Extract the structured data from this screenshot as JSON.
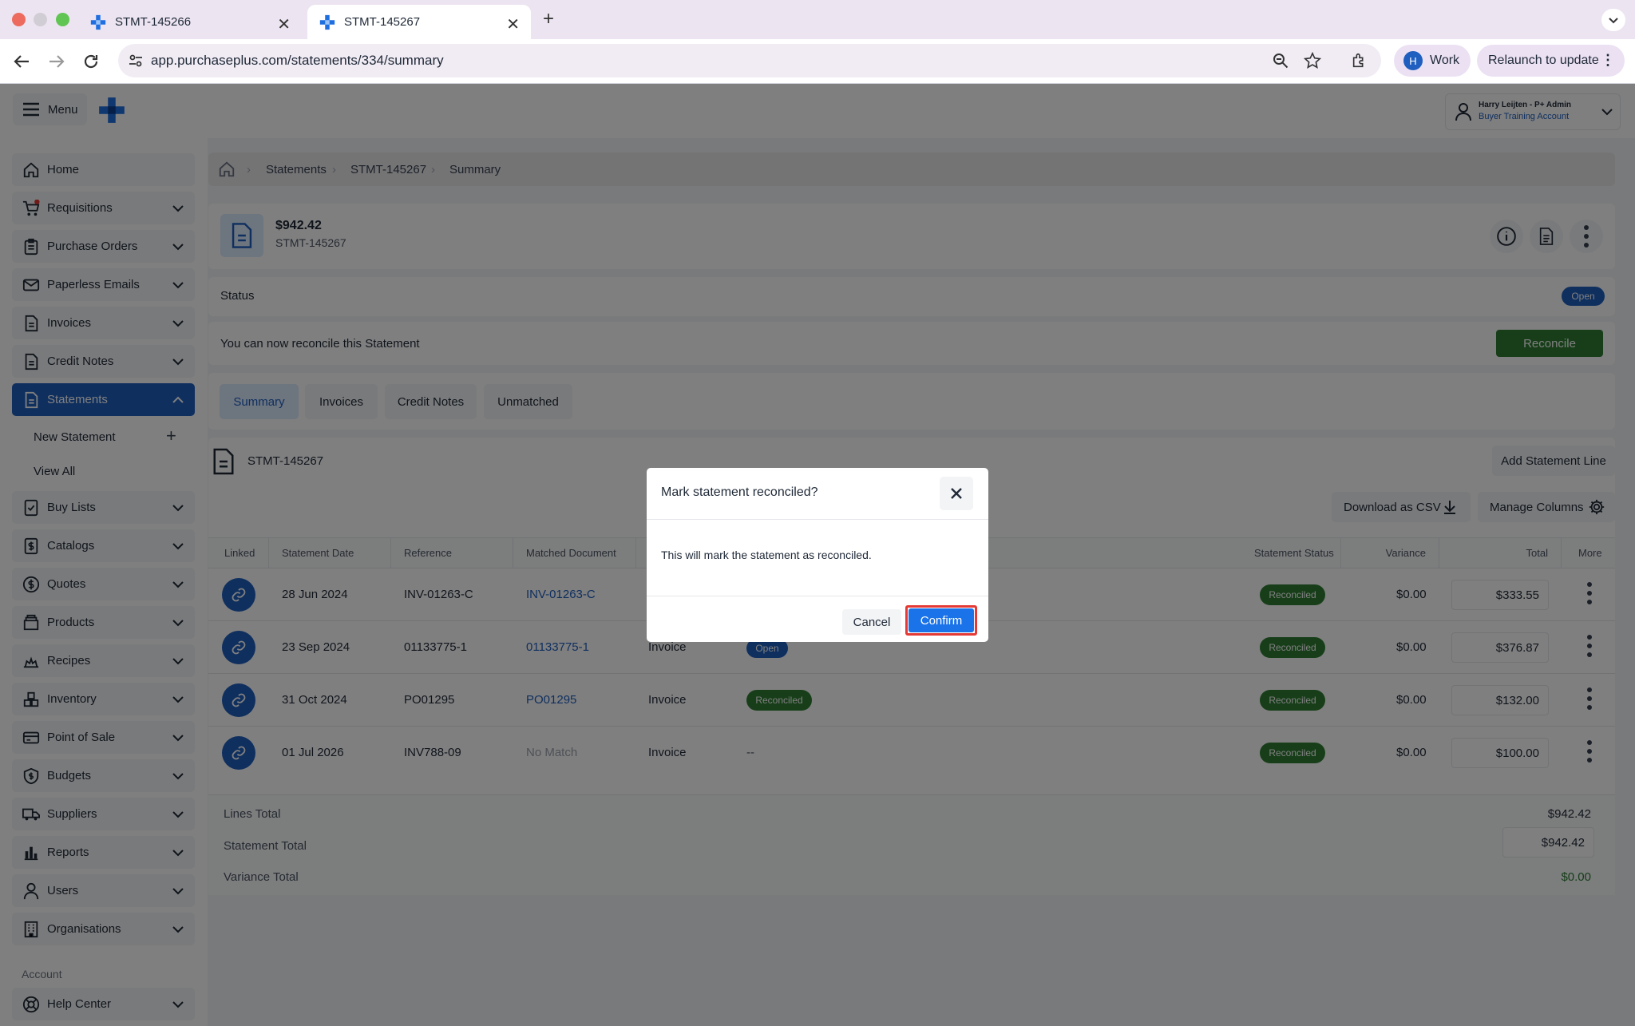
{
  "browser": {
    "tabs": [
      {
        "title": "STMT-145266"
      },
      {
        "title": "STMT-145267"
      }
    ],
    "url": "app.purchaseplus.com/statements/334/summary",
    "profile_initial": "H",
    "profile_label": "Work",
    "relaunch_label": "Relaunch to update"
  },
  "header": {
    "menu_label": "Menu",
    "user_name": "Harry Leijten - P+ Admin",
    "account_name": "Buyer Training Account"
  },
  "sidebar": {
    "items": [
      {
        "label": "Home",
        "icon": "home-icon"
      },
      {
        "label": "Requisitions",
        "icon": "cart-icon"
      },
      {
        "label": "Purchase Orders",
        "icon": "clipboard-icon"
      },
      {
        "label": "Paperless Emails",
        "icon": "mail-icon"
      },
      {
        "label": "Invoices",
        "icon": "document-icon"
      },
      {
        "label": "Credit Notes",
        "icon": "document-icon"
      },
      {
        "label": "Statements",
        "icon": "document-icon"
      },
      {
        "label": "Buy Lists",
        "icon": "checklist-icon"
      },
      {
        "label": "Catalogs",
        "icon": "catalog-icon"
      },
      {
        "label": "Quotes",
        "icon": "dollar-icon"
      },
      {
        "label": "Products",
        "icon": "box-icon"
      },
      {
        "label": "Recipes",
        "icon": "chef-icon"
      },
      {
        "label": "Inventory",
        "icon": "inventory-icon"
      },
      {
        "label": "Point of Sale",
        "icon": "card-icon"
      },
      {
        "label": "Budgets",
        "icon": "shield-dollar-icon"
      },
      {
        "label": "Suppliers",
        "icon": "truck-icon"
      },
      {
        "label": "Reports",
        "icon": "bar-chart-icon"
      },
      {
        "label": "Users",
        "icon": "user-icon"
      },
      {
        "label": "Organisations",
        "icon": "building-icon"
      }
    ],
    "sub_new": "New Statement",
    "sub_view_all": "View All",
    "account_section": "Account",
    "help_center": "Help Center"
  },
  "breadcrumb": [
    "Statements",
    "STMT-145267",
    "Summary"
  ],
  "statement": {
    "amount": "$942.42",
    "id": "STMT-145267",
    "status_label": "Status",
    "status_value": "Open",
    "reconcile_message": "You can now reconcile this Statement",
    "reconcile_button": "Reconcile"
  },
  "tabs": [
    "Summary",
    "Invoices",
    "Credit Notes",
    "Unmatched"
  ],
  "lines": {
    "title": "STMT-145267",
    "add_line": "Add Statement Line",
    "download_csv": "Download as CSV",
    "manage_columns": "Manage Columns",
    "columns": [
      "Linked",
      "Statement Date",
      "Reference",
      "Matched Document",
      "Statement Status",
      "Variance",
      "Total",
      "More"
    ],
    "rows": [
      {
        "date": "28 Jun 2024",
        "reference": "INV-01263-C",
        "matched": "INV-01263-C",
        "type": "",
        "doc_status": "",
        "statement_status": "Reconciled",
        "variance": "$0.00",
        "total": "$333.55"
      },
      {
        "date": "23 Sep 2024",
        "reference": "01133775-1",
        "matched": "01133775-1",
        "type": "Invoice",
        "doc_status": "Open",
        "statement_status": "Reconciled",
        "variance": "$0.00",
        "total": "$376.87"
      },
      {
        "date": "31 Oct 2024",
        "reference": "PO01295",
        "matched": "PO01295",
        "type": "Invoice",
        "doc_status": "Reconciled",
        "statement_status": "Reconciled",
        "variance": "$0.00",
        "total": "$132.00"
      },
      {
        "date": "01 Jul 2026",
        "reference": "INV788-09",
        "matched": "No Match",
        "type": "Invoice",
        "doc_status": "--",
        "statement_status": "Reconciled",
        "variance": "$0.00",
        "total": "$100.00"
      }
    ]
  },
  "totals": {
    "lines_total_label": "Lines Total",
    "lines_total": "$942.42",
    "statement_total_label": "Statement Total",
    "statement_total": "$942.42",
    "variance_total_label": "Variance Total",
    "variance_total": "$0.00"
  },
  "modal": {
    "title": "Mark statement reconciled?",
    "body": "This will mark the statement as reconciled.",
    "cancel": "Cancel",
    "confirm": "Confirm"
  },
  "colors": {
    "primary": "#1f5fbf",
    "success": "#2e7d32",
    "confirm": "#1a73e8",
    "highlight": "#e53935"
  }
}
